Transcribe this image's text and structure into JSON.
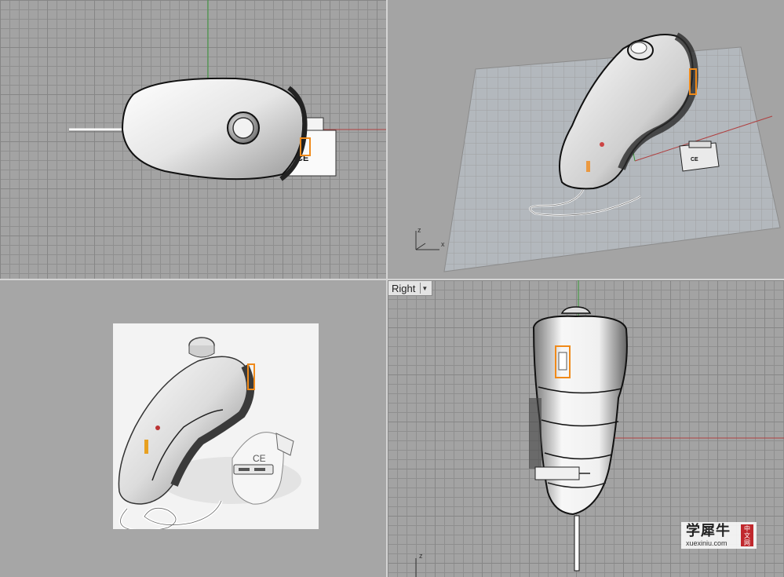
{
  "viewports": {
    "top": {},
    "perspective": {
      "axis_labels": {
        "z": "z",
        "x": "x"
      },
      "device_label": "CE"
    },
    "render": {
      "device_label": "CE"
    },
    "right": {
      "title": "Right",
      "axis_labels": {
        "z": "z"
      }
    }
  },
  "top_view": {
    "device_label": "CE"
  },
  "watermark": {
    "title": "学犀牛",
    "url": "xuexiniu.com",
    "badge": [
      "中",
      "文",
      "网"
    ]
  },
  "colors": {
    "x_axis": "#b04040",
    "y_axis": "#3a9a3a",
    "highlight": "#f08a1a"
  },
  "icons": [
    "dropdown-arrow-icon"
  ]
}
